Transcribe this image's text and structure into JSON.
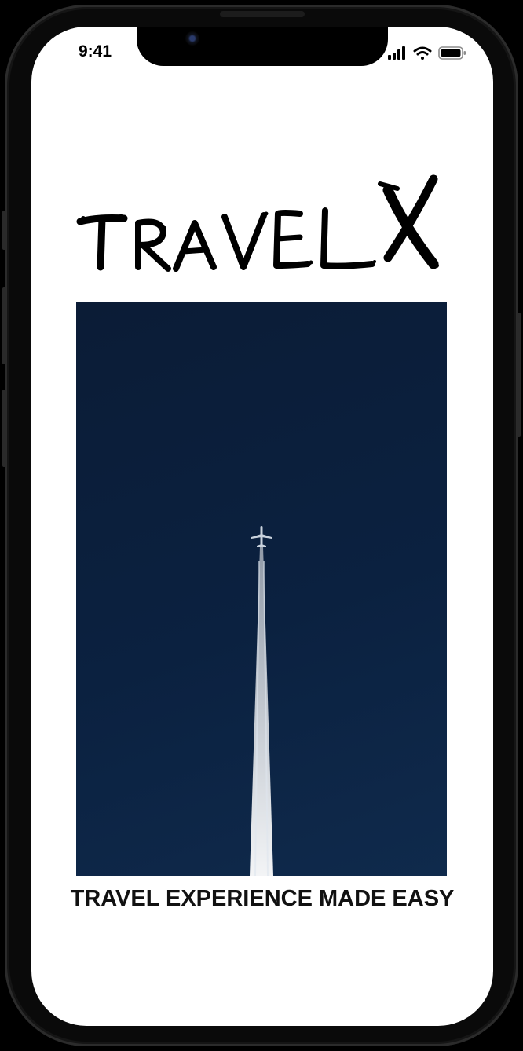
{
  "status_bar": {
    "time": "9:41",
    "icons": [
      "cellular-signal-icon",
      "wifi-icon",
      "battery-icon"
    ]
  },
  "app": {
    "logo_text": "TRAVELX",
    "hero_image": {
      "subject": "airplane-with-contrail-icon",
      "sky_color": "#0b2140"
    },
    "tagline": "TRAVEL EXPERIENCE MADE EASY"
  },
  "colors": {
    "background": "#ffffff",
    "text": "#111111",
    "device_frame": "#0a0a0a"
  }
}
